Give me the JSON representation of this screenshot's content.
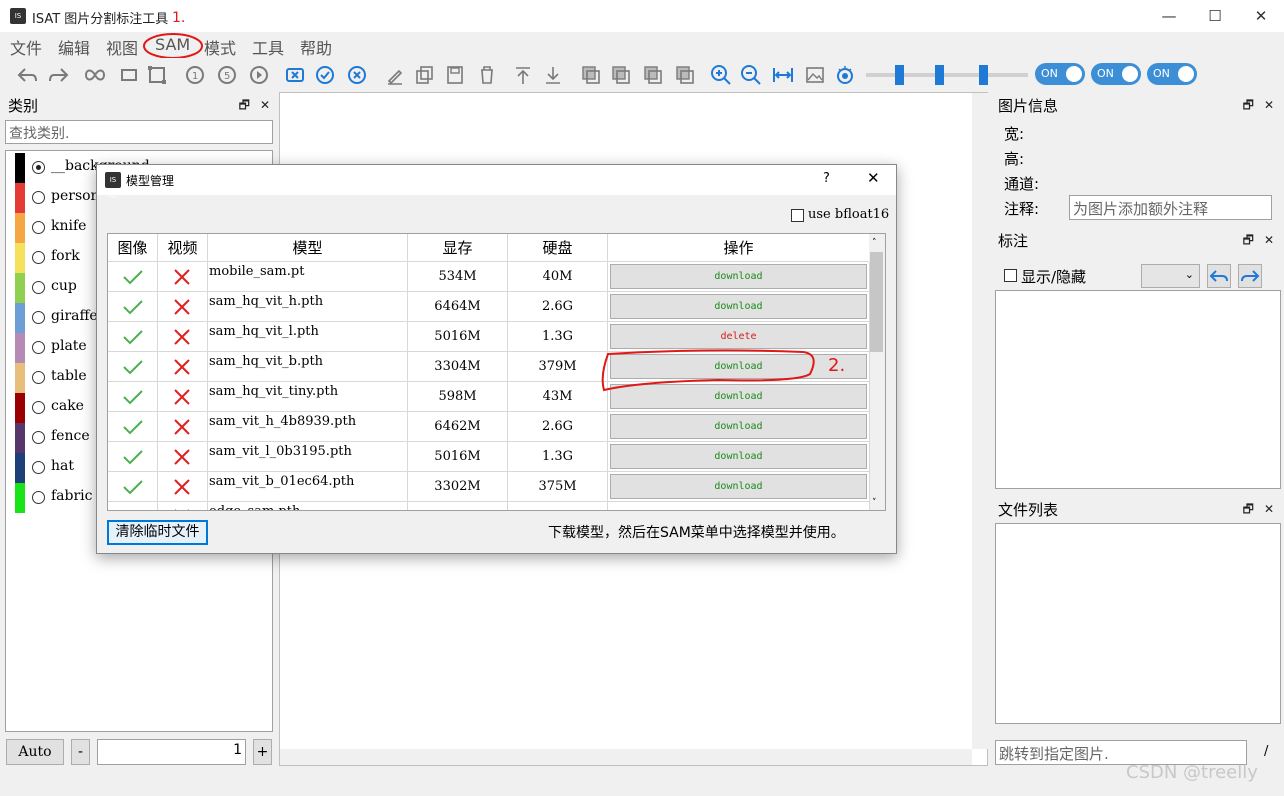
{
  "app": {
    "title": "ISAT 图片分割标注工具",
    "icon_text": "IS AT"
  },
  "window_controls": {
    "minimize": "—",
    "maximize": "☐",
    "close": "✕"
  },
  "menu": [
    "文件",
    "编辑",
    "视图",
    "SAM",
    "模式",
    "工具",
    "帮助"
  ],
  "annotations": {
    "step1": "1.",
    "step2": "2."
  },
  "toolbar": {
    "icons": [
      "undo-icon",
      "redo-icon",
      "infinity-icon",
      "rectangle-icon",
      "bbox-icon",
      "prev-icon",
      "five-icon",
      "next-icon",
      "cancel-x-icon",
      "confirm-icon",
      "delete-x-icon",
      "edit-icon",
      "copy-icon",
      "save-icon",
      "trash-icon",
      "move-up-icon",
      "move-down-icon",
      "layer1-icon",
      "layer2-icon",
      "layer3-icon",
      "layer4-icon",
      "zoom-in-icon",
      "zoom-out-icon",
      "fit-icon",
      "image-icon",
      "eye-icon"
    ],
    "toggles": [
      "ON",
      "ON",
      "ON"
    ],
    "sliders": [
      0.55,
      0.3,
      0.25
    ],
    "accent": "#1e7ad6"
  },
  "category_panel": {
    "title": "类别",
    "search_placeholder": "查找类别.",
    "items": [
      {
        "label": "__background__",
        "color": "#000000",
        "selected": true
      },
      {
        "label": "person",
        "color": "#e53935"
      },
      {
        "label": "knife",
        "color": "#f4a742"
      },
      {
        "label": "fork",
        "color": "#f5e15b"
      },
      {
        "label": "cup",
        "color": "#8fd14f"
      },
      {
        "label": "giraffe",
        "color": "#6d9ed6"
      },
      {
        "label": "plate",
        "color": "#b58ab5"
      },
      {
        "label": "table",
        "color": "#e7bf7b"
      },
      {
        "label": "cake",
        "color": "#9b0000"
      },
      {
        "label": "fence",
        "color": "#56366b"
      },
      {
        "label": "hat",
        "color": "#1f3f7a"
      },
      {
        "label": "fabric",
        "color": "#18e418"
      }
    ],
    "auto_button": "Auto",
    "minus": "-",
    "plus": "+",
    "spin_value": "1"
  },
  "image_info_panel": {
    "title": "图片信息",
    "width_label": "宽:",
    "height_label": "高:",
    "channel_label": "通道:",
    "note_label": "注释:",
    "note_placeholder": "为图片添加额外注释"
  },
  "annotation_panel": {
    "title": "标注",
    "show_hide": "显示/隐藏"
  },
  "file_list_panel": {
    "title": "文件列表",
    "jump_placeholder": "跳转到指定图片.",
    "slash": "/"
  },
  "panel_buttons": {
    "float": "🗗",
    "close": "✕"
  },
  "dialog": {
    "title": "模型管理",
    "help": "?",
    "close": "✕",
    "bfloat16_label": "use bfloat16",
    "columns": [
      "图像",
      "视频",
      "模型",
      "显存",
      "硬盘",
      "操作"
    ],
    "rows": [
      {
        "model": "mobile_sam.pt",
        "vram": "534M",
        "disk": "40M",
        "action": "download"
      },
      {
        "model": "sam_hq_vit_h.pth",
        "vram": "6464M",
        "disk": "2.6G",
        "action": "download"
      },
      {
        "model": "sam_hq_vit_l.pth",
        "vram": "5016M",
        "disk": "1.3G",
        "action": "delete"
      },
      {
        "model": "sam_hq_vit_b.pth",
        "vram": "3304M",
        "disk": "379M",
        "action": "download"
      },
      {
        "model": "sam_hq_vit_tiny.pth",
        "vram": "598M",
        "disk": "43M",
        "action": "download"
      },
      {
        "model": "sam_vit_h_4b8939.pth",
        "vram": "6462M",
        "disk": "2.6G",
        "action": "download"
      },
      {
        "model": "sam_vit_l_0b3195.pth",
        "vram": "5016M",
        "disk": "1.3G",
        "action": "download"
      },
      {
        "model": "sam_vit_b_01ec64.pth",
        "vram": "3302M",
        "disk": "375M",
        "action": "download"
      },
      {
        "model": "edge_sam.pth",
        "vram": "",
        "disk": "",
        "action": ""
      }
    ],
    "clear_button": "清除临时文件",
    "hint": "下载模型，然后在SAM菜单中选择模型并使用。",
    "colors": {
      "download": "#1a8a1a",
      "delete": "#d42020",
      "check": "#4caf50",
      "cross": "#e02020"
    }
  },
  "watermark": "CSDN @treelly"
}
